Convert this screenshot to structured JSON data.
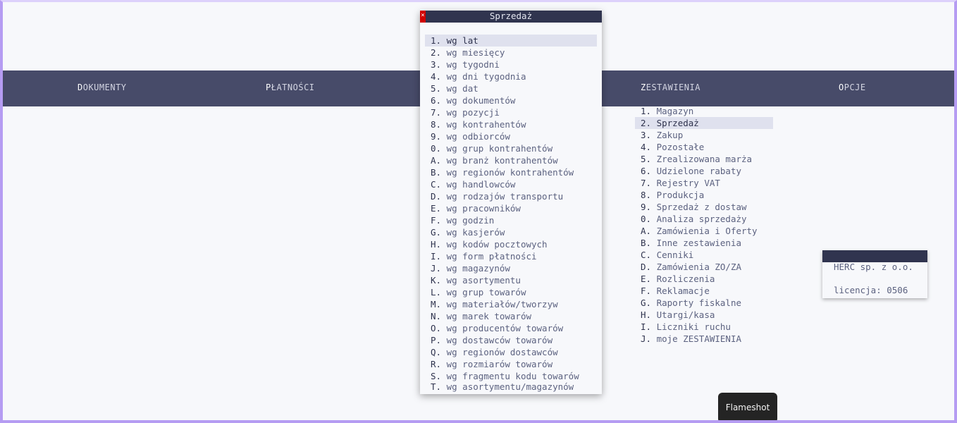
{
  "menubar": {
    "items": [
      {
        "hot": "D",
        "rest": "OKUMENTY"
      },
      {
        "hot": "P",
        "rest": "ŁATNOŚCI"
      },
      {
        "hot": "Z",
        "rest": "ESTAWIENIA"
      },
      {
        "hot": "O",
        "rest": "PCJE"
      }
    ]
  },
  "zestawienia": {
    "items": [
      {
        "key": "1.",
        "label": "Magazyn"
      },
      {
        "key": "2.",
        "label": "Sprzedaż"
      },
      {
        "key": "3.",
        "label": "Zakup"
      },
      {
        "key": "4.",
        "label": "Pozostałe"
      },
      {
        "key": "5.",
        "label": "Zrealizowana marża"
      },
      {
        "key": "6.",
        "label": "Udzielone rabaty"
      },
      {
        "key": "7.",
        "label": "Rejestry VAT"
      },
      {
        "key": "8.",
        "label": "Produkcja"
      },
      {
        "key": "9.",
        "label": "Sprzedaż z dostaw"
      },
      {
        "key": "0.",
        "label": "Analiza sprzedaży"
      },
      {
        "key": "A.",
        "label": "Zamówienia i Oferty"
      },
      {
        "key": "B.",
        "label": "Inne zestawienia"
      },
      {
        "key": "C.",
        "label": "Cenniki"
      },
      {
        "key": "D.",
        "label": "Zamówienia ZO/ZA"
      },
      {
        "key": "E.",
        "label": "Rozliczenia"
      },
      {
        "key": "F.",
        "label": "Reklamacje"
      },
      {
        "key": "G.",
        "label": "Raporty fiskalne"
      },
      {
        "key": "H.",
        "label": "Utargi/kasa"
      },
      {
        "key": "I.",
        "label": "Liczniki ruchu"
      },
      {
        "key": "J.",
        "label": "moje ZESTAWIENIA"
      }
    ]
  },
  "dialog": {
    "title": "Sprzedaż",
    "close_glyph": "×",
    "items": [
      {
        "key": "1.",
        "label": "wg lat"
      },
      {
        "key": "2.",
        "label": "wg miesięcy"
      },
      {
        "key": "3.",
        "label": "wg tygodni"
      },
      {
        "key": "4.",
        "label": "wg dni tygodnia"
      },
      {
        "key": "5.",
        "label": "wg dat"
      },
      {
        "key": "6.",
        "label": "wg dokumentów"
      },
      {
        "key": "7.",
        "label": "wg pozycji"
      },
      {
        "key": "8.",
        "label": "wg kontrahentów"
      },
      {
        "key": "9.",
        "label": "wg odbiorców"
      },
      {
        "key": "0.",
        "label": "wg grup kontrahentów"
      },
      {
        "key": "A.",
        "label": "wg branż kontrahentów"
      },
      {
        "key": "B.",
        "label": "wg regionów kontrahentów"
      },
      {
        "key": "C.",
        "label": "wg handlowców"
      },
      {
        "key": "D.",
        "label": "wg rodzajów transportu"
      },
      {
        "key": "E.",
        "label": "wg pracowników"
      },
      {
        "key": "F.",
        "label": "wg godzin"
      },
      {
        "key": "G.",
        "label": "wg kasjerów"
      },
      {
        "key": "H.",
        "label": "wg kodów pocztowych"
      },
      {
        "key": "I.",
        "label": "wg form płatności"
      },
      {
        "key": "J.",
        "label": "wg magazynów"
      },
      {
        "key": "K.",
        "label": "wg asortymentu"
      },
      {
        "key": "L.",
        "label": "wg grup towarów"
      },
      {
        "key": "M.",
        "label": "wg materiałów/tworzyw"
      },
      {
        "key": "N.",
        "label": "wg marek towarów"
      },
      {
        "key": "O.",
        "label": "wg producentów towarów"
      },
      {
        "key": "P.",
        "label": "wg dostawców towarów"
      },
      {
        "key": "Q.",
        "label": "wg regionów dostawców"
      },
      {
        "key": "R.",
        "label": "wg rozmiarów towarów"
      },
      {
        "key": "S.",
        "label": "wg fragmentu kodu towarów"
      },
      {
        "key": "T.",
        "label": "wg asortymentu/magazynów"
      }
    ]
  },
  "info": {
    "company": "HERC sp. z o.o.",
    "license": "licencja: 0506"
  },
  "tooltip": {
    "text": "Flameshot"
  },
  "colors": {
    "menubar_bg": "#474b69",
    "title_bg": "#30344f",
    "selection_bg": "#dfe1ee",
    "close_red": "#d00000",
    "frame_purple": "#b59cf2"
  }
}
